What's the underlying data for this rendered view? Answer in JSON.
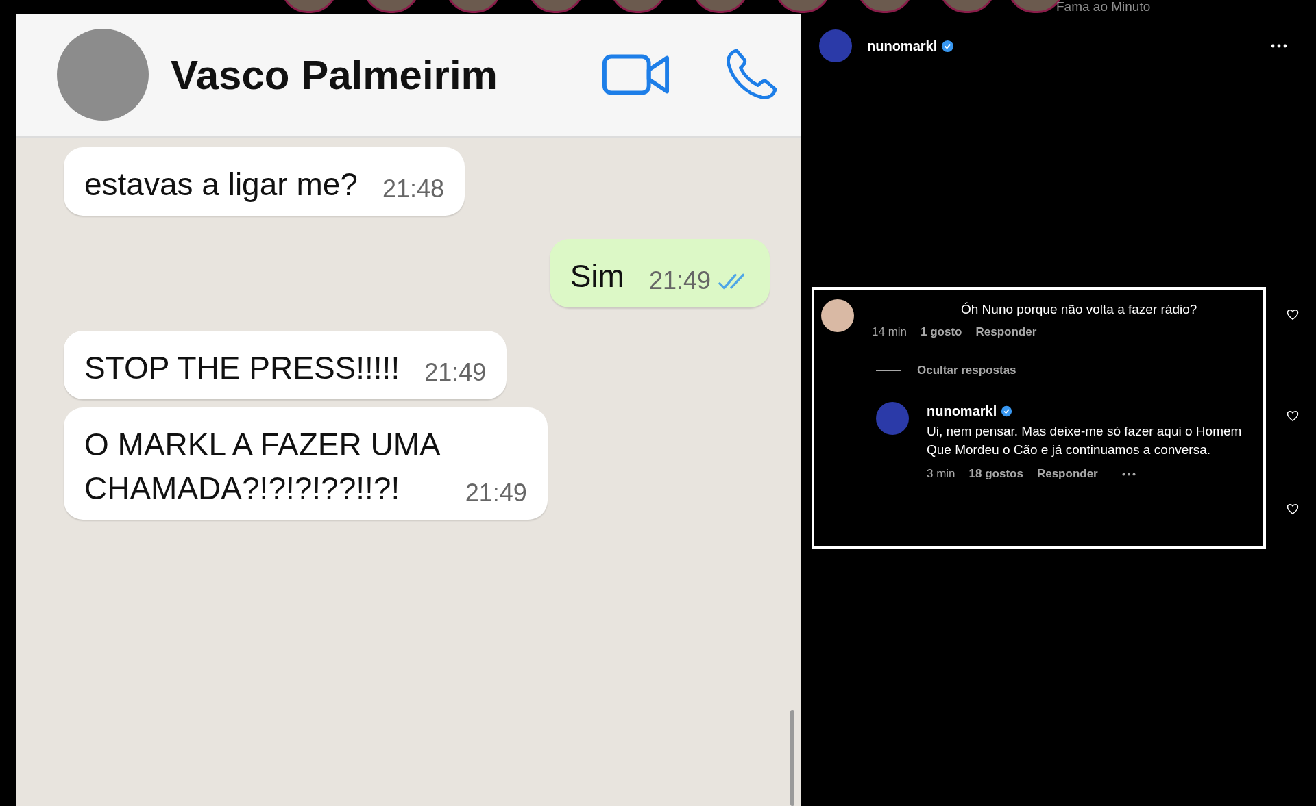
{
  "stories_bar": {
    "account_label": "Fama ao Minuto"
  },
  "post": {
    "chat": {
      "contact_name": "Vasco Palmeirim",
      "messages": [
        {
          "kind": "incoming",
          "lines": [
            "estavas a ligar me?"
          ],
          "time": "21:48",
          "read": false
        },
        {
          "kind": "outgoing",
          "lines": [
            "Sim"
          ],
          "time": "21:49",
          "read": true
        },
        {
          "kind": "incoming",
          "lines": [
            "STOP THE PRESS!!!!!"
          ],
          "time": "21:49",
          "read": false
        },
        {
          "kind": "incoming",
          "lines": [
            "O MARKL A FAZER UMA",
            "CHAMADA?!?!?!??!!?!"
          ],
          "time": "21:49",
          "read": false
        }
      ]
    }
  },
  "panel": {
    "author": {
      "username": "nunomarkl",
      "verified": true
    },
    "comment": {
      "text": "Óh Nuno porque não volta a fazer rádio?",
      "time": "14 min",
      "likes": "1 gosto",
      "reply_label": "Responder",
      "liked": false
    },
    "toggle_label": "Ocultar respostas",
    "reply": {
      "username": "nunomarkl",
      "verified": true,
      "text": "Ui, nem pensar. Mas deixe-me só fazer aqui o Homem Que Mordeu o Cão e já continuamos a conversa.",
      "time": "3 min",
      "likes": "18 gostos",
      "reply_label": "Responder",
      "liked": false
    },
    "extra_liked": false
  }
}
